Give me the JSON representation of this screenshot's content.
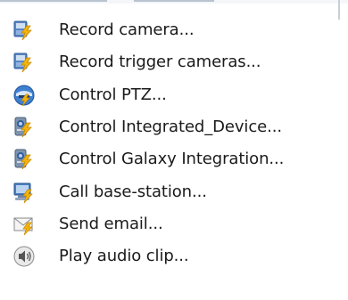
{
  "menu": {
    "items": [
      {
        "label": "Record camera...",
        "icon": "record-camera-icon"
      },
      {
        "label": "Record trigger cameras...",
        "icon": "record-trigger-cameras-icon"
      },
      {
        "label": "Control PTZ...",
        "icon": "ptz-control-icon"
      },
      {
        "label": "Control Integrated_Device...",
        "icon": "integrated-device-icon"
      },
      {
        "label": "Control Galaxy Integration...",
        "icon": "galaxy-integration-icon"
      },
      {
        "label": "Call base-station...",
        "icon": "base-station-icon"
      },
      {
        "label": "Send email...",
        "icon": "send-email-icon"
      },
      {
        "label": "Play audio clip...",
        "icon": "audio-clip-icon"
      }
    ]
  },
  "colors": {
    "background": "#ffffff",
    "text": "#1a1a1a",
    "lightning": "#f2b30c",
    "icon_blue": "#2d6fb8",
    "hover": "#e5f1fb"
  }
}
